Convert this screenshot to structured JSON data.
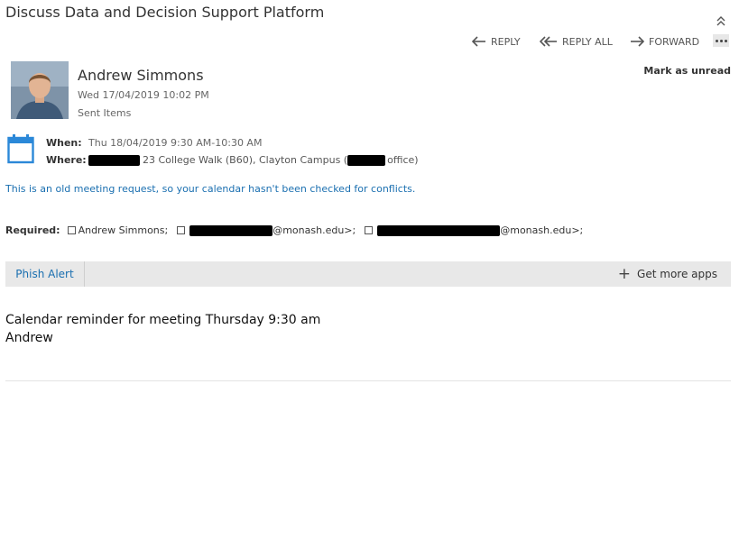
{
  "subject": "Discuss Data and Decision Support Platform",
  "actions": {
    "reply": "REPLY",
    "reply_all": "REPLY ALL",
    "forward": "FORWARD"
  },
  "mark_unread": "Mark as unread",
  "sender": {
    "name": "Andrew Simmons",
    "date": "Wed 17/04/2019 10:02 PM",
    "folder": "Sent Items"
  },
  "meeting": {
    "when_label": "When:",
    "when_value": "Thu 18/04/2019 9:30 AM-10:30 AM",
    "where_label": "Where:",
    "where_part1": "23 College Walk (B60), Clayton Campus (",
    "where_part2": "office)"
  },
  "notice": "This is an old meeting request, so your calendar hasn't been checked for conflicts.",
  "required": {
    "label": "Required:",
    "attendee1": "Andrew Simmons;",
    "attendee2_suffix": "@monash.edu>;",
    "attendee3_suffix": "@monash.edu>;"
  },
  "addins": {
    "phish_alert": "Phish Alert",
    "get_more_apps": "Get more apps"
  },
  "body": {
    "line1": "Calendar reminder for meeting Thursday 9:30 am",
    "line2": "Andrew"
  },
  "colors": {
    "link_blue": "#1a6fb0",
    "calendar_blue": "#2b88d8",
    "bar_gray": "#e8e8e8"
  }
}
